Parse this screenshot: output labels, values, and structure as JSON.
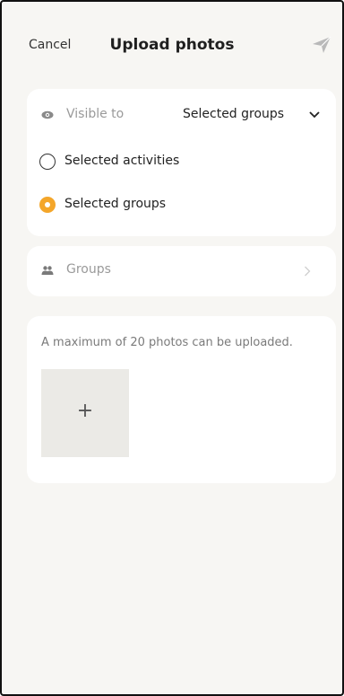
{
  "header": {
    "cancel_label": "Cancel",
    "title": "Upload photos",
    "send_icon": "send-icon"
  },
  "visibility": {
    "label": "Visible to",
    "value": "Selected groups",
    "icon": "eye-icon",
    "options": [
      {
        "label": "Selected activities",
        "selected": false
      },
      {
        "label": "Selected groups",
        "selected": true
      }
    ]
  },
  "groups": {
    "label": "Groups",
    "icon": "people-icon"
  },
  "photos": {
    "max_text": "A maximum of 20 photos can be uploaded.",
    "add_symbol": "+"
  },
  "colors": {
    "accent": "#f4a62a",
    "background": "#f7f6f3"
  }
}
